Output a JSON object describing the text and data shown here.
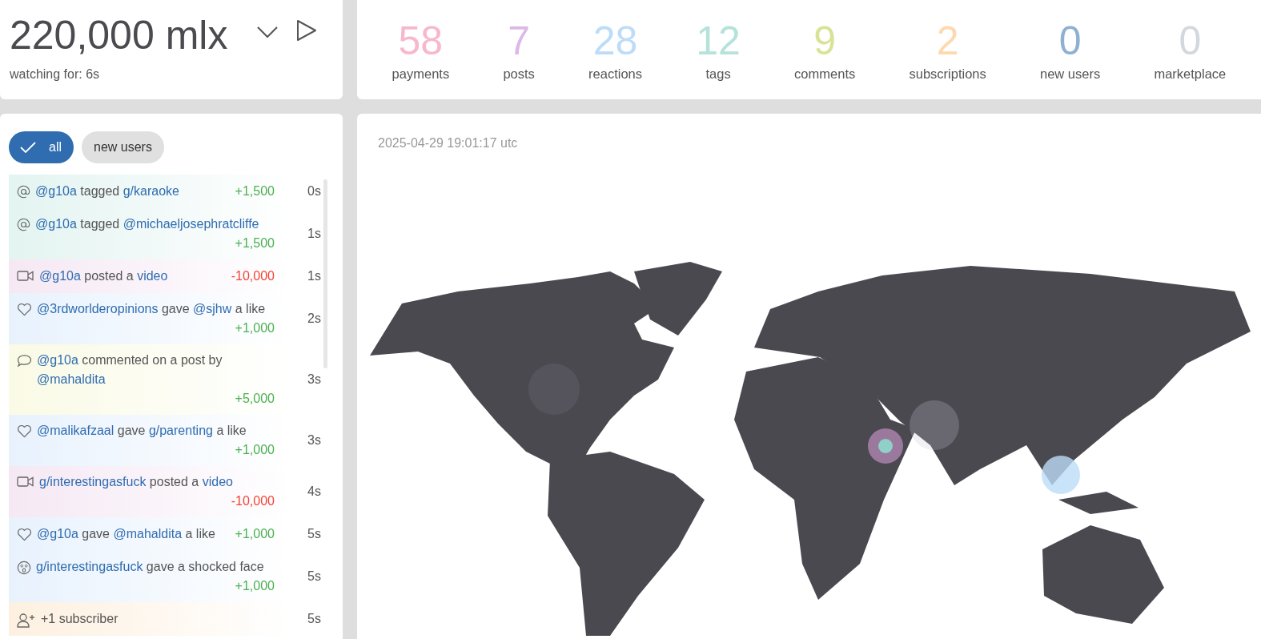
{
  "balance": {
    "value": "220,000 mlx",
    "subtitle": "watching for: 6s"
  },
  "stats": [
    {
      "value": "58",
      "label": "payments",
      "color": "#f7b8cc"
    },
    {
      "value": "7",
      "label": "posts",
      "color": "#dcb9e6"
    },
    {
      "value": "28",
      "label": "reactions",
      "color": "#bcdcf8"
    },
    {
      "value": "12",
      "label": "tags",
      "color": "#b5e2da"
    },
    {
      "value": "9",
      "label": "comments",
      "color": "#d9e396"
    },
    {
      "value": "2",
      "label": "subscriptions",
      "color": "#fdd9b0"
    },
    {
      "value": "0",
      "label": "new users",
      "color": "#8fb0d3"
    },
    {
      "value": "0",
      "label": "marketplace",
      "color": "#d3d8de"
    }
  ],
  "filters": [
    {
      "label": "all",
      "selected": true
    },
    {
      "label": "new users",
      "selected": false
    }
  ],
  "feed": [
    {
      "kind": "tag",
      "parts": [
        {
          "text": "@g10a",
          "link": true
        },
        {
          "text": " tagged ",
          "link": false
        },
        {
          "text": "g/karaoke",
          "link": true
        }
      ],
      "amount": "+1,500",
      "gain": true,
      "time": "0s"
    },
    {
      "kind": "tag",
      "parts": [
        {
          "text": "@g10a",
          "link": true
        },
        {
          "text": " tagged ",
          "link": false
        },
        {
          "text": "@michaeljosephratcliffe",
          "link": true
        }
      ],
      "amount": "+1,500",
      "gain": true,
      "time": "1s"
    },
    {
      "kind": "video",
      "parts": [
        {
          "text": "@g10a",
          "link": true
        },
        {
          "text": " posted a ",
          "link": false
        },
        {
          "text": "video",
          "link": true
        }
      ],
      "amount": "-10,000",
      "gain": false,
      "time": "1s"
    },
    {
      "kind": "like",
      "parts": [
        {
          "text": "@3rdworlderopinions",
          "link": true
        },
        {
          "text": " gave ",
          "link": false
        },
        {
          "text": "@sjhw",
          "link": true
        },
        {
          "text": " a like",
          "link": false
        }
      ],
      "amount": "+1,000",
      "gain": true,
      "time": "2s"
    },
    {
      "kind": "comment",
      "parts": [
        {
          "text": "@g10a",
          "link": true
        },
        {
          "text": " commented on a post by ",
          "link": false
        },
        {
          "text": "@mahaldita",
          "link": true
        }
      ],
      "amount": "+5,000",
      "gain": true,
      "time": "3s"
    },
    {
      "kind": "like",
      "parts": [
        {
          "text": "@malikafzaal",
          "link": true
        },
        {
          "text": " gave ",
          "link": false
        },
        {
          "text": "g/parenting",
          "link": true
        },
        {
          "text": " a like",
          "link": false
        }
      ],
      "amount": "+1,000",
      "gain": true,
      "time": "3s"
    },
    {
      "kind": "video",
      "parts": [
        {
          "text": "g/interestingasfuck",
          "link": true
        },
        {
          "text": " posted a ",
          "link": false
        },
        {
          "text": "video",
          "link": true
        }
      ],
      "amount": "-10,000",
      "gain": false,
      "time": "4s"
    },
    {
      "kind": "like",
      "parts": [
        {
          "text": "@g10a",
          "link": true
        },
        {
          "text": " gave ",
          "link": false
        },
        {
          "text": "@mahaldita",
          "link": true
        },
        {
          "text": " a like",
          "link": false
        }
      ],
      "amount": "+1,000",
      "gain": true,
      "time": "5s"
    },
    {
      "kind": "shocked",
      "parts": [
        {
          "text": "g/interestingasfuck",
          "link": true
        },
        {
          "text": " gave a shocked face",
          "link": false
        }
      ],
      "amount": "+1,000",
      "gain": true,
      "time": "5s"
    },
    {
      "kind": "subscriber",
      "parts": [
        {
          "text": "+1 subscriber",
          "link": false
        }
      ],
      "time": "5s"
    }
  ],
  "map": {
    "timestamp": "2025-04-29 19:01:17 utc"
  }
}
